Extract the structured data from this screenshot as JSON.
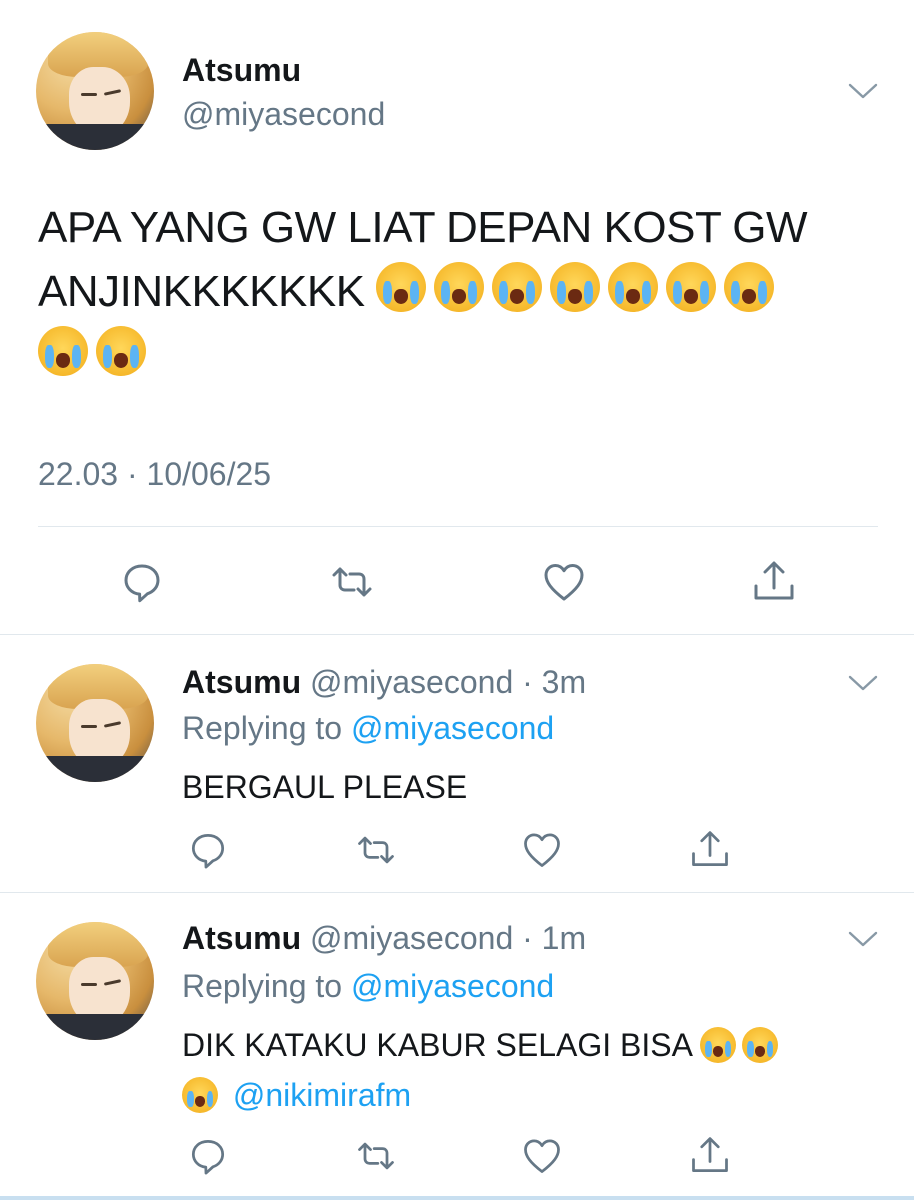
{
  "main_tweet": {
    "name": "Atsumu",
    "handle": "@miyasecond",
    "text_line1": "APA YANG GW LIAT DEPAN KOST GW",
    "text_line2": "ANJINKKKKKKK",
    "emoji_count": 9,
    "emoji_name": "loudly-crying-face",
    "time": "22.03 · 10/06/25"
  },
  "replies": [
    {
      "name": "Atsumu",
      "handle": "@miyasecond",
      "meta": "@miyasecond · 3m",
      "replying_prefix": "Replying to ",
      "replying_handle": "@miyasecond",
      "text": "BERGAUL PLEASE"
    },
    {
      "name": "Atsumu",
      "handle": "@miyasecond",
      "meta": "@miyasecond · 1m",
      "replying_prefix": "Replying to ",
      "replying_handle": "@miyasecond",
      "text": "DIK KATAKU KABUR SELAGI BISA",
      "mention": "@nikimirafm",
      "emoji_count": 3
    }
  ],
  "icons": {
    "reply": "reply-icon",
    "retweet": "retweet-icon",
    "like": "heart-icon",
    "share": "share-icon",
    "menu": "chevron-down-icon"
  },
  "colors": {
    "text": "#14171a",
    "secondary": "#657786",
    "link": "#1da1f2",
    "divider": "#e1e8ed"
  }
}
